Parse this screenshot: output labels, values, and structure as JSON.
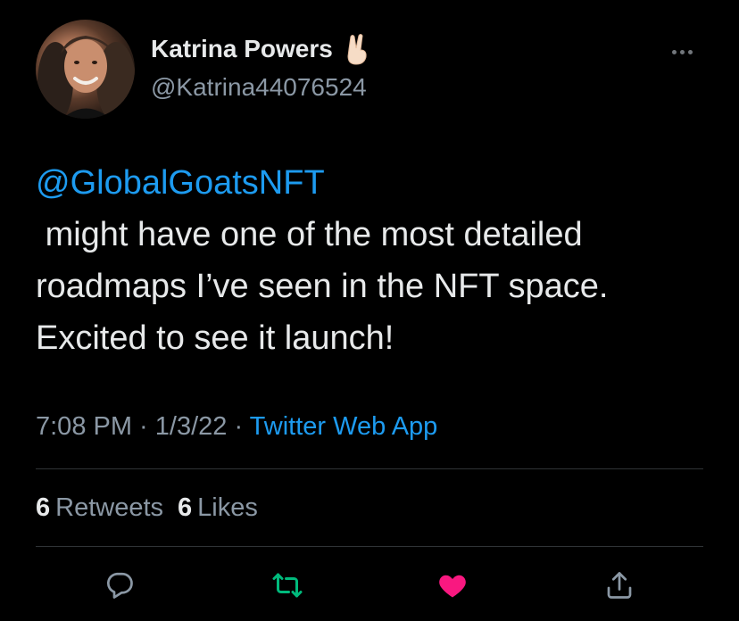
{
  "author": {
    "display_name": "Katrina Powers",
    "handle": "@Katrina44076524",
    "name_emoji": "victory-hand-emoji"
  },
  "tweet": {
    "mention": "@GlobalGoatsNFT",
    "text": " might have one of the most detailed\nroadmaps I’ve seen in the NFT space.\nExcited to see it launch!",
    "time": "7:08 PM",
    "separator1": " · ",
    "date": "1/3/22",
    "separator2": " · ",
    "source": "Twitter Web App"
  },
  "stats": {
    "retweets_count": "6",
    "retweets_label": "Retweets",
    "likes_count": "6",
    "likes_label": "Likes"
  },
  "actions": {
    "reply_icon": "reply-icon",
    "retweet_icon": "retweet-icon",
    "like_icon": "heart-icon",
    "share_icon": "share-icon",
    "retweet_color": "#00ba7c",
    "like_color": "#f91880",
    "liked": true,
    "retweeted": true
  },
  "colors": {
    "background": "#000000",
    "link": "#1d9bf0",
    "text_primary": "#e7e9ea",
    "text_secondary": "#8b98a5",
    "divider": "#2f3336"
  }
}
